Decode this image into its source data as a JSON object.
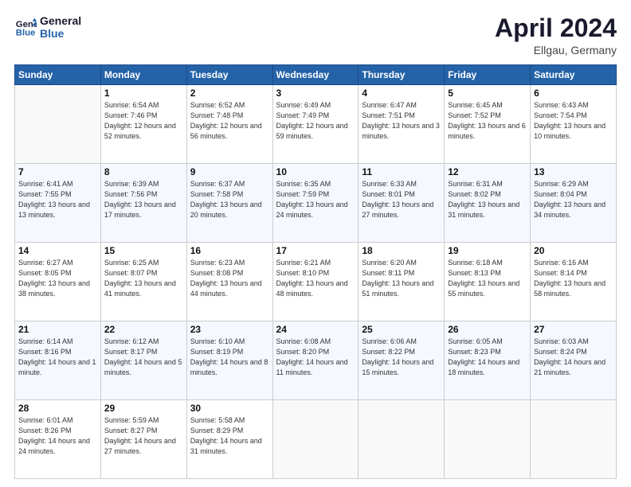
{
  "header": {
    "logo_line1": "General",
    "logo_line2": "Blue",
    "month": "April 2024",
    "location": "Ellgau, Germany"
  },
  "weekdays": [
    "Sunday",
    "Monday",
    "Tuesday",
    "Wednesday",
    "Thursday",
    "Friday",
    "Saturday"
  ],
  "weeks": [
    [
      {
        "day": "",
        "info": ""
      },
      {
        "day": "1",
        "info": "Sunrise: 6:54 AM\nSunset: 7:46 PM\nDaylight: 12 hours\nand 52 minutes."
      },
      {
        "day": "2",
        "info": "Sunrise: 6:52 AM\nSunset: 7:48 PM\nDaylight: 12 hours\nand 56 minutes."
      },
      {
        "day": "3",
        "info": "Sunrise: 6:49 AM\nSunset: 7:49 PM\nDaylight: 12 hours\nand 59 minutes."
      },
      {
        "day": "4",
        "info": "Sunrise: 6:47 AM\nSunset: 7:51 PM\nDaylight: 13 hours\nand 3 minutes."
      },
      {
        "day": "5",
        "info": "Sunrise: 6:45 AM\nSunset: 7:52 PM\nDaylight: 13 hours\nand 6 minutes."
      },
      {
        "day": "6",
        "info": "Sunrise: 6:43 AM\nSunset: 7:54 PM\nDaylight: 13 hours\nand 10 minutes."
      }
    ],
    [
      {
        "day": "7",
        "info": "Sunrise: 6:41 AM\nSunset: 7:55 PM\nDaylight: 13 hours\nand 13 minutes."
      },
      {
        "day": "8",
        "info": "Sunrise: 6:39 AM\nSunset: 7:56 PM\nDaylight: 13 hours\nand 17 minutes."
      },
      {
        "day": "9",
        "info": "Sunrise: 6:37 AM\nSunset: 7:58 PM\nDaylight: 13 hours\nand 20 minutes."
      },
      {
        "day": "10",
        "info": "Sunrise: 6:35 AM\nSunset: 7:59 PM\nDaylight: 13 hours\nand 24 minutes."
      },
      {
        "day": "11",
        "info": "Sunrise: 6:33 AM\nSunset: 8:01 PM\nDaylight: 13 hours\nand 27 minutes."
      },
      {
        "day": "12",
        "info": "Sunrise: 6:31 AM\nSunset: 8:02 PM\nDaylight: 13 hours\nand 31 minutes."
      },
      {
        "day": "13",
        "info": "Sunrise: 6:29 AM\nSunset: 8:04 PM\nDaylight: 13 hours\nand 34 minutes."
      }
    ],
    [
      {
        "day": "14",
        "info": "Sunrise: 6:27 AM\nSunset: 8:05 PM\nDaylight: 13 hours\nand 38 minutes."
      },
      {
        "day": "15",
        "info": "Sunrise: 6:25 AM\nSunset: 8:07 PM\nDaylight: 13 hours\nand 41 minutes."
      },
      {
        "day": "16",
        "info": "Sunrise: 6:23 AM\nSunset: 8:08 PM\nDaylight: 13 hours\nand 44 minutes."
      },
      {
        "day": "17",
        "info": "Sunrise: 6:21 AM\nSunset: 8:10 PM\nDaylight: 13 hours\nand 48 minutes."
      },
      {
        "day": "18",
        "info": "Sunrise: 6:20 AM\nSunset: 8:11 PM\nDaylight: 13 hours\nand 51 minutes."
      },
      {
        "day": "19",
        "info": "Sunrise: 6:18 AM\nSunset: 8:13 PM\nDaylight: 13 hours\nand 55 minutes."
      },
      {
        "day": "20",
        "info": "Sunrise: 6:16 AM\nSunset: 8:14 PM\nDaylight: 13 hours\nand 58 minutes."
      }
    ],
    [
      {
        "day": "21",
        "info": "Sunrise: 6:14 AM\nSunset: 8:16 PM\nDaylight: 14 hours\nand 1 minute."
      },
      {
        "day": "22",
        "info": "Sunrise: 6:12 AM\nSunset: 8:17 PM\nDaylight: 14 hours\nand 5 minutes."
      },
      {
        "day": "23",
        "info": "Sunrise: 6:10 AM\nSunset: 8:19 PM\nDaylight: 14 hours\nand 8 minutes."
      },
      {
        "day": "24",
        "info": "Sunrise: 6:08 AM\nSunset: 8:20 PM\nDaylight: 14 hours\nand 11 minutes."
      },
      {
        "day": "25",
        "info": "Sunrise: 6:06 AM\nSunset: 8:22 PM\nDaylight: 14 hours\nand 15 minutes."
      },
      {
        "day": "26",
        "info": "Sunrise: 6:05 AM\nSunset: 8:23 PM\nDaylight: 14 hours\nand 18 minutes."
      },
      {
        "day": "27",
        "info": "Sunrise: 6:03 AM\nSunset: 8:24 PM\nDaylight: 14 hours\nand 21 minutes."
      }
    ],
    [
      {
        "day": "28",
        "info": "Sunrise: 6:01 AM\nSunset: 8:26 PM\nDaylight: 14 hours\nand 24 minutes."
      },
      {
        "day": "29",
        "info": "Sunrise: 5:59 AM\nSunset: 8:27 PM\nDaylight: 14 hours\nand 27 minutes."
      },
      {
        "day": "30",
        "info": "Sunrise: 5:58 AM\nSunset: 8:29 PM\nDaylight: 14 hours\nand 31 minutes."
      },
      {
        "day": "",
        "info": ""
      },
      {
        "day": "",
        "info": ""
      },
      {
        "day": "",
        "info": ""
      },
      {
        "day": "",
        "info": ""
      }
    ]
  ]
}
